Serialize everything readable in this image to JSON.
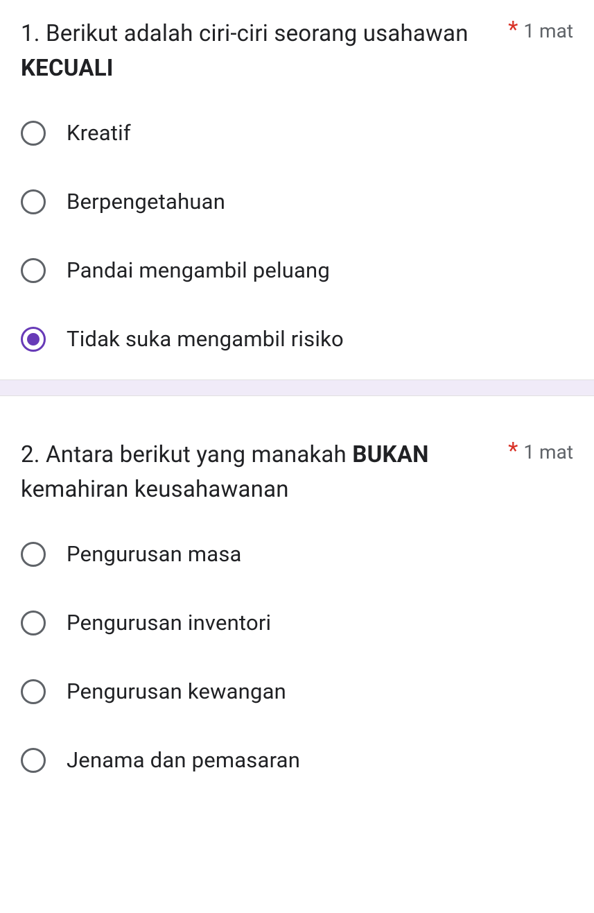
{
  "questions": [
    {
      "number_prefix": "1. ",
      "text_part1": "Berikut adalah ciri-ciri seorang usahawan ",
      "text_bold": "KECUALI",
      "required_mark": "*",
      "points": "1 mat",
      "options": [
        {
          "label": "Kreatif",
          "selected": false
        },
        {
          "label": "Berpengetahuan",
          "selected": false
        },
        {
          "label": "Pandai mengambil peluang",
          "selected": false
        },
        {
          "label": "Tidak suka mengambil risiko",
          "selected": true
        }
      ]
    },
    {
      "number_prefix": "2. ",
      "text_part1": "Antara berikut yang manakah ",
      "text_bold": "BUKAN",
      "text_part2": " kemahiran keusahawanan",
      "required_mark": "*",
      "points": "1 mat",
      "options": [
        {
          "label": "Pengurusan masa",
          "selected": false
        },
        {
          "label": "Pengurusan inventori",
          "selected": false
        },
        {
          "label": "Pengurusan kewangan",
          "selected": false
        },
        {
          "label": "Jenama dan pemasaran",
          "selected": false
        }
      ]
    }
  ]
}
